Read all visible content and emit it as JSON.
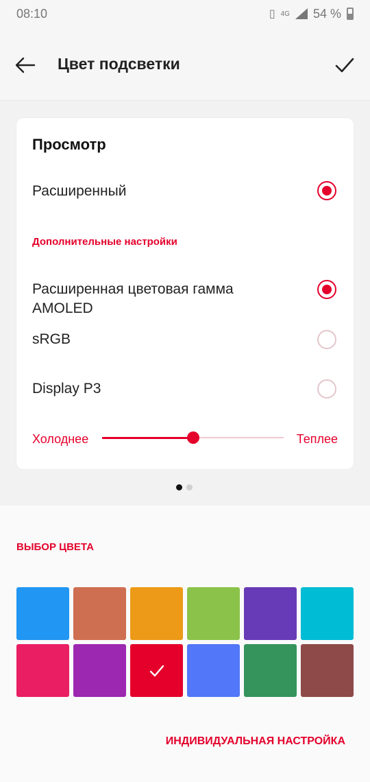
{
  "status": {
    "time": "08:10",
    "battery": "54 %",
    "network": "4G"
  },
  "header": {
    "title": "Цвет подсветки",
    "back_icon": "arrow-left-icon",
    "confirm_icon": "check-icon"
  },
  "preview_card": {
    "title": "Просмотр",
    "mode_label": "Расширенный",
    "mode_selected": true,
    "advanced_title": "Дополнительные настройки",
    "options": [
      {
        "label": "Расширенная цветовая гамма AMOLED",
        "selected": true
      },
      {
        "label": "sRGB",
        "selected": false
      },
      {
        "label": "Display P3",
        "selected": false
      }
    ],
    "slider": {
      "left_label": "Холоднее",
      "right_label": "Теплее",
      "value": 0.5
    }
  },
  "pager": {
    "count": 2,
    "active": 0
  },
  "color_choice": {
    "title": "ВЫБОР ЦВЕТА",
    "swatches": [
      "#2196f3",
      "#cf6f51",
      "#ec9a17",
      "#8bc34a",
      "#673ab7",
      "#00bcd4",
      "#e91e63",
      "#9c27b0",
      "#e4002b",
      "#5277f8",
      "#35935c",
      "#8d4a48"
    ],
    "selected_index": 8,
    "custom_label": "ИНДИВИДУАЛЬНАЯ НАСТРОЙКА"
  },
  "accent": "#e4002b"
}
